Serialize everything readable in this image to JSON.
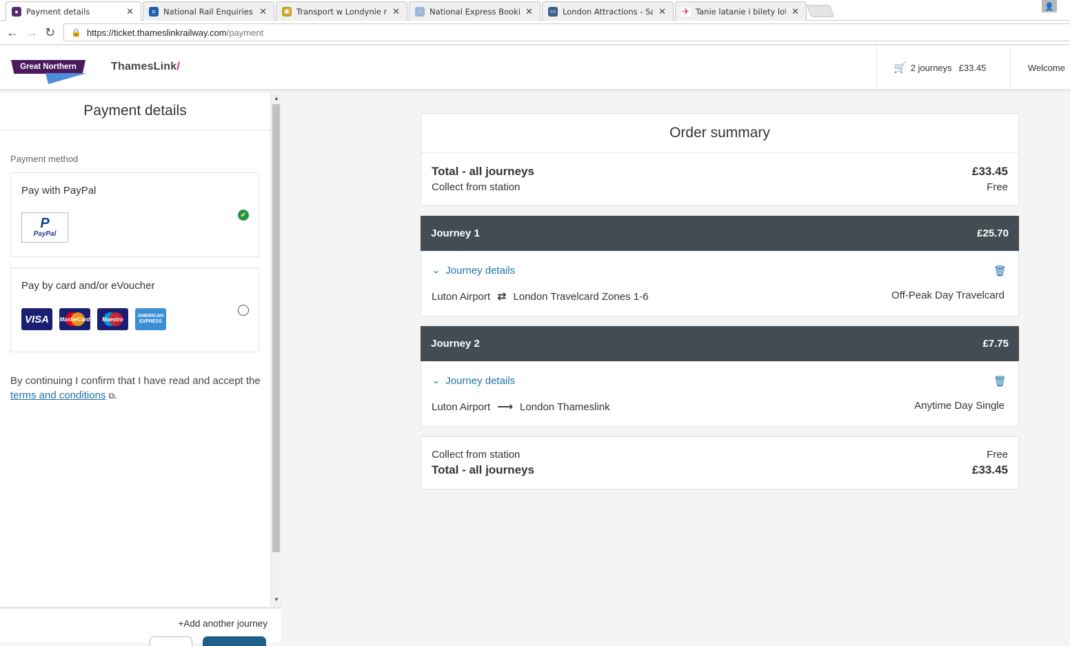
{
  "browser": {
    "tabs": [
      {
        "title": "Payment details",
        "favicon_color": "#5b2a6e",
        "active": true
      },
      {
        "title": "National Rail Enquiries - I",
        "favicon_color": "#1d5fa8",
        "active": false
      },
      {
        "title": "Transport w Londynie na",
        "favicon_color": "#c9a227",
        "active": false
      },
      {
        "title": "National Express Booking",
        "favicon_color": "#9ab7d6",
        "active": false
      },
      {
        "title": "London Attractions - Sav",
        "favicon_color": "#3a5f8a",
        "active": false
      },
      {
        "title": "Tanie latanie i bilety lotni",
        "favicon_color": "#e03a3a",
        "active": false
      }
    ],
    "url_host": "https://ticket.thameslinkrailway.com",
    "url_path": "/payment"
  },
  "header": {
    "gn_logo": "Great Northern",
    "tl_logo": "ThamesLink",
    "tl_slash": "/",
    "cart_count": "2 journeys",
    "cart_total": "£33.45",
    "welcome": "Welcome"
  },
  "sidebar": {
    "title": "Payment details",
    "payment_method_label": "Payment method",
    "paypal": {
      "title": "Pay with PayPal",
      "logo_text": "PayPal",
      "selected": true
    },
    "card": {
      "title": "Pay by card and/or eVoucher",
      "selected": false,
      "brands": [
        "VISA",
        "MasterCard",
        "Maestro",
        "AMERICAN EXPRESS"
      ]
    },
    "terms_prefix": "By continuing I confirm that I have read and accept the ",
    "terms_link": "terms and conditions",
    "terms_suffix": ".",
    "add_journey": "+Add another journey"
  },
  "summary": {
    "title": "Order summary",
    "total_label": "Total - all journeys",
    "total_value": "£33.45",
    "collect_label": "Collect from station",
    "collect_value": "Free"
  },
  "journeys": [
    {
      "name": "Journey 1",
      "price": "£25.70",
      "details_label": "Journey details",
      "from": "Luton Airport",
      "direction": "return",
      "to": "London Travelcard Zones 1-6",
      "ticket": "Off-Peak Day Travelcard"
    },
    {
      "name": "Journey 2",
      "price": "£7.75",
      "details_label": "Journey details",
      "from": "Luton Airport",
      "direction": "single",
      "to": "London Thameslink",
      "ticket": "Anytime Day Single"
    }
  ],
  "footer_summary": {
    "collect_label": "Collect from station",
    "collect_value": "Free",
    "total_label": "Total - all journeys",
    "total_value": "£33.45"
  },
  "colors": {
    "brand_purple": "#4a1a5c",
    "link_blue": "#1e73a8",
    "journey_header": "#434c52",
    "selected_green": "#27963b"
  }
}
